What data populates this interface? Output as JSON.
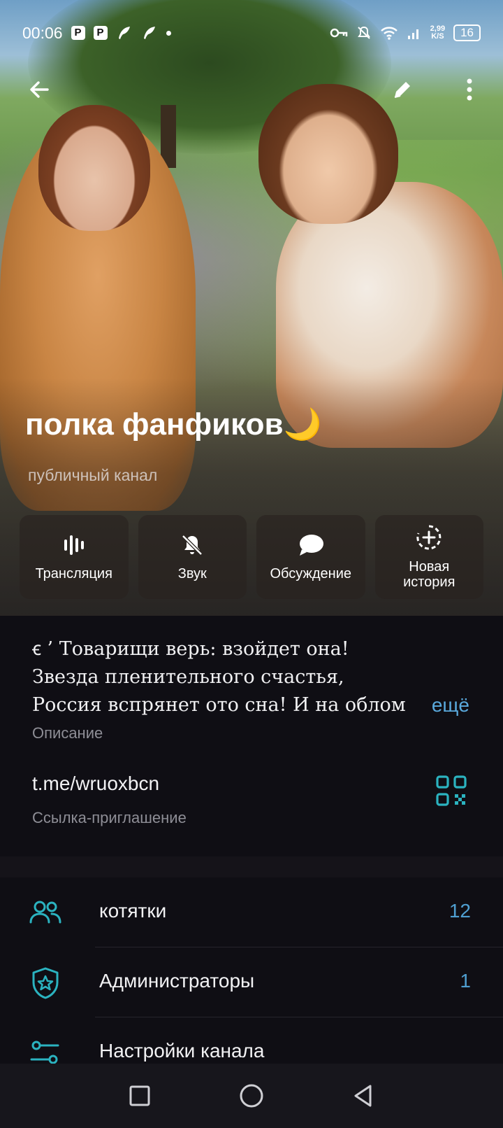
{
  "status_bar": {
    "time": "00:06",
    "badge_1": "P",
    "badge_2": "P",
    "net_speed_value": "2,99",
    "net_speed_unit": "K/S",
    "battery": "16"
  },
  "header": {
    "title": "полка фанфиков🌙",
    "subtitle": "публичный канал"
  },
  "actions": [
    {
      "label": "Трансляция",
      "icon": "live-stream-icon"
    },
    {
      "label": "Звук",
      "icon": "bell-muted-icon"
    },
    {
      "label": "Обсуждение",
      "icon": "chat-bubble-icon"
    },
    {
      "label": "Новая\nистория",
      "icon": "new-story-icon"
    }
  ],
  "info": {
    "description_lines": [
      "ꞓ ’ Товарищи верь: взойдет она!",
      "Звезда пленительного счастья,",
      "Россия вспрянет ото сна! И на облом"
    ],
    "more_label": "ещё",
    "description_caption": "Описание",
    "invite_link": "t.me/wruoxbcn",
    "invite_caption": "Ссылка-приглашение"
  },
  "list": [
    {
      "label": "котятки",
      "count": "12",
      "icon": "subscribers-icon"
    },
    {
      "label": "Администраторы",
      "count": "1",
      "icon": "admin-shield-icon"
    },
    {
      "label": "Настройки канала",
      "count": "",
      "icon": "settings-sliders-icon"
    }
  ],
  "colors": {
    "accent": "#4f9fd1",
    "icon_teal": "#2bb3c0",
    "background": "#0f0e14"
  }
}
